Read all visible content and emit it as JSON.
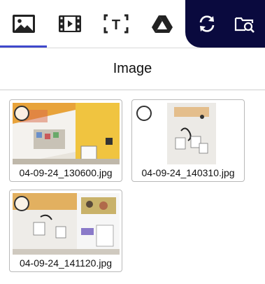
{
  "toolbar": {
    "tabs": [
      {
        "icon": "image-icon",
        "active": true
      },
      {
        "icon": "video-icon",
        "active": false
      },
      {
        "icon": "text-icon",
        "glyph": "T",
        "active": false
      },
      {
        "icon": "google-drive-icon",
        "active": false
      }
    ],
    "actions": [
      {
        "icon": "refresh-icon"
      },
      {
        "icon": "folder-search-icon"
      }
    ],
    "accent_color": "#3f48cc",
    "panel_color": "#0a0a3e"
  },
  "panel": {
    "title": "Image"
  },
  "images": [
    {
      "filename": "04-09-24_130600.jpg",
      "selected": false
    },
    {
      "filename": "04-09-24_140310.jpg",
      "selected": false
    },
    {
      "filename": "04-09-24_141120.jpg",
      "selected": false
    }
  ]
}
